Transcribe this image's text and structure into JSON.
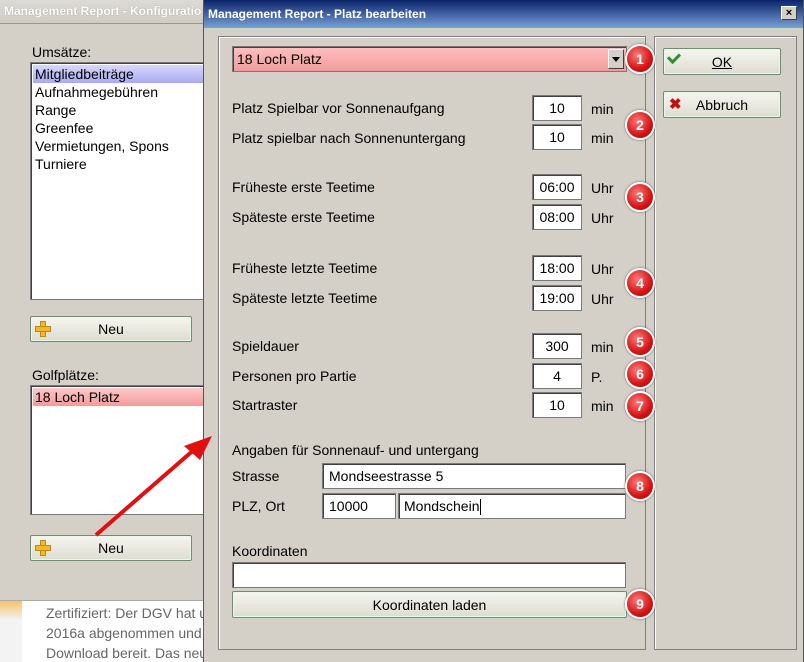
{
  "background_window": {
    "title": "Management Report - Konfiguratio",
    "umsaetze_label": "Umsätze:",
    "umsaetze_items": [
      "Mitgliedbeiträge",
      "Aufnahmegebühren",
      "Range",
      "Greenfee",
      "Vermietungen, Spons",
      "Turniere"
    ],
    "new_button_1": "Neu",
    "golfplaetze_label": "Golfplätze:",
    "golfplaetze_items": [
      "18 Loch Platz"
    ],
    "new_button_2": "Neu"
  },
  "background_page": {
    "lines": [
      "Zertifiziert: Der DGV hat u",
      "2016a abgenommen und",
      "Download bereit. Das neu"
    ]
  },
  "dialog": {
    "title": "Management Report - Platz bearbeiten",
    "close_glyph": "×",
    "course_select": {
      "value": "18 Loch Platz"
    },
    "ok_label": "OK",
    "cancel_label": "Abbruch",
    "rows": {
      "sunrise": {
        "label": "Platz Spielbar vor Sonnenaufgang",
        "value": "10",
        "unit": "min"
      },
      "sunset": {
        "label": "Platz spielbar nach Sonnenuntergang",
        "value": "10",
        "unit": "min"
      },
      "earliest_first": {
        "label": "Früheste erste Teetime",
        "value": "06:00",
        "unit": "Uhr"
      },
      "latest_first": {
        "label": "Späteste erste Teetime",
        "value": "08:00",
        "unit": "Uhr"
      },
      "earliest_last": {
        "label": "Früheste letzte Teetime",
        "value": "18:00",
        "unit": "Uhr"
      },
      "latest_last": {
        "label": "Späteste letzte Teetime",
        "value": "19:00",
        "unit": "Uhr"
      },
      "duration": {
        "label": "Spieldauer",
        "value": "300",
        "unit": "min"
      },
      "players": {
        "label": "Personen pro Partie",
        "value": "4",
        "unit": "P."
      },
      "interval": {
        "label": "Startraster",
        "value": "10",
        "unit": "min"
      }
    },
    "sun_section_title": "Angaben  für Sonnenauf- und untergang",
    "street_label": "Strasse",
    "street_value": "Mondseestrasse 5",
    "plz_label": "PLZ, Ort",
    "plz_value": "10000",
    "city_value": "Mondschein",
    "coords_label": "Koordinaten",
    "coords_value": "",
    "load_coords_button": "Koordinaten laden",
    "badges": [
      "1",
      "2",
      "3",
      "4",
      "5",
      "6",
      "7",
      "8",
      "9"
    ]
  },
  "colors": {
    "selection_red": "#f29a9a",
    "selection_blue": "#a9a9ef",
    "badge_red": "#d41414",
    "title_blue": "#0a246a",
    "arrow_red": "#e01010"
  }
}
